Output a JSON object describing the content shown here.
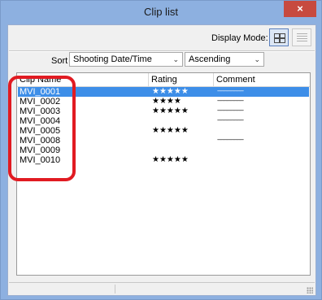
{
  "window": {
    "title": "Clip list",
    "close_label": "×"
  },
  "toolbar": {
    "display_mode_label": "Display Mode:",
    "mode_buttons": [
      "grid-view-icon",
      "list-view-icon"
    ]
  },
  "sort": {
    "label": "Sort",
    "field_value": "Shooting Date/Time",
    "order_value": "Ascending"
  },
  "table": {
    "columns": [
      "Clip Name",
      "Rating",
      "Comment"
    ],
    "rows": [
      {
        "name": "MVI_0001",
        "rating": "★★★★★",
        "comment": "------------------------",
        "selected": true
      },
      {
        "name": "MVI_0002",
        "rating": "★★★★",
        "comment": "------------------------"
      },
      {
        "name": "MVI_0003",
        "rating": "★★★★★",
        "comment": "------------------------"
      },
      {
        "name": "MVI_0004",
        "rating": "",
        "comment": "------------------------"
      },
      {
        "name": "MVI_0005",
        "rating": "★★★★★",
        "comment": ""
      },
      {
        "name": "MVI_0008",
        "rating": "",
        "comment": "------------------------"
      },
      {
        "name": "MVI_0009",
        "rating": "",
        "comment": ""
      },
      {
        "name": "MVI_0010",
        "rating": "★★★★★",
        "comment": ""
      }
    ]
  },
  "colors": {
    "title_bar": "#8db0e0",
    "close_button": "#c74a3f",
    "selection": "#3d8ee8",
    "highlight": "#e11b22"
  }
}
